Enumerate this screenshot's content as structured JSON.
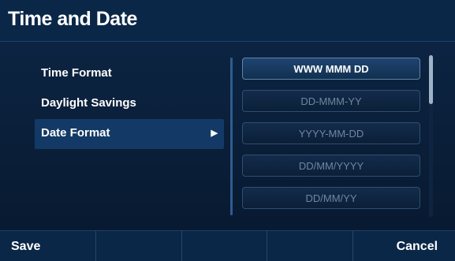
{
  "header": {
    "title": "Time and Date"
  },
  "menu": {
    "items": [
      {
        "label": "Time Format"
      },
      {
        "label": "Daylight Savings"
      },
      {
        "label": "Date Format"
      }
    ],
    "selected_arrow": "▶"
  },
  "options": [
    {
      "label": "WWW MMM DD"
    },
    {
      "label": "DD-MMM-YY"
    },
    {
      "label": "YYYY-MM-DD"
    },
    {
      "label": "DD/MM/YYYY"
    },
    {
      "label": "DD/MM/YY"
    }
  ],
  "softkeys": [
    {
      "label": "Save"
    },
    {
      "label": ""
    },
    {
      "label": ""
    },
    {
      "label": ""
    },
    {
      "label": "Cancel"
    }
  ],
  "colors": {
    "titlebar": "#0a2747",
    "selected_item": "#133a66",
    "text": "#ffffff",
    "dim_text": "#6f86a1"
  }
}
